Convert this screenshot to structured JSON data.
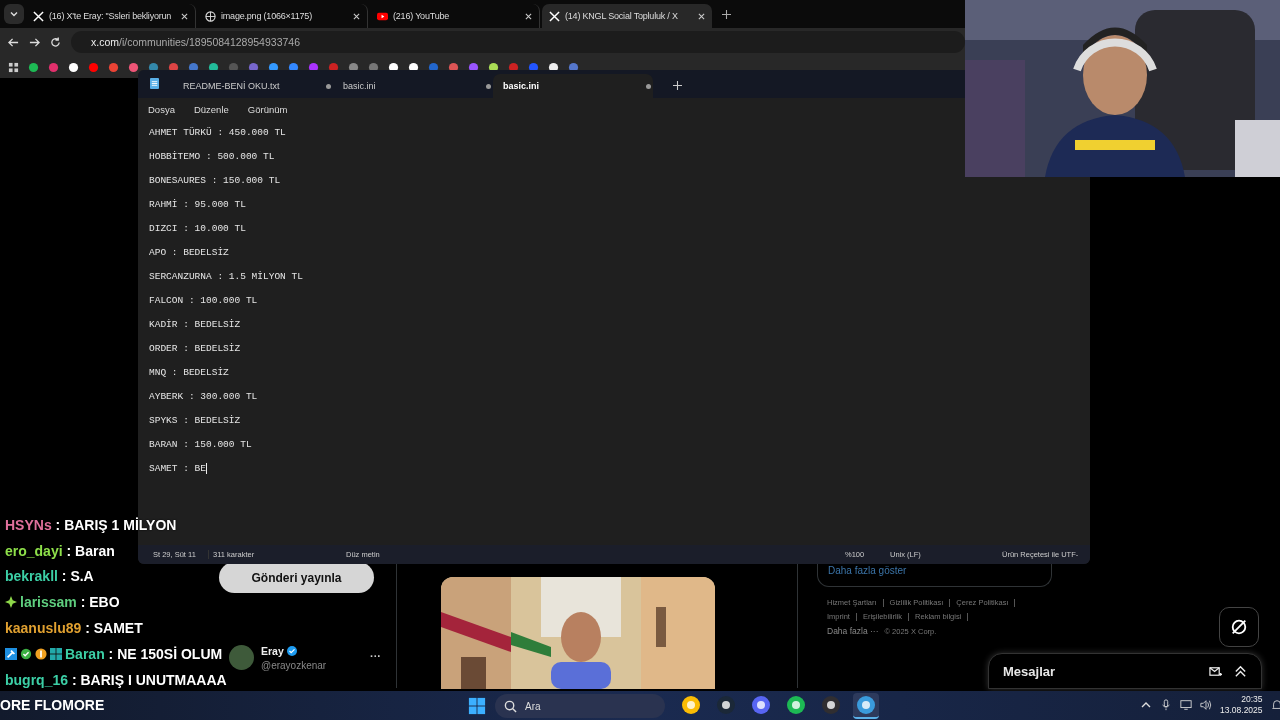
{
  "browser": {
    "tabs": [
      {
        "title": "(16) X'te Eray: \"Ssleri bekliyorun",
        "kind": "x",
        "selected": false
      },
      {
        "title": "image.png (1066×1175)",
        "kind": "globe",
        "selected": false
      },
      {
        "title": "(216) YouTube",
        "kind": "youtube",
        "selected": false
      },
      {
        "title": "(14) KNGL Social Topluluk / X",
        "kind": "x",
        "selected": true
      }
    ],
    "address": {
      "host": "x.com",
      "path": "/i/communities/1895084128954933746"
    },
    "page": {
      "post_button": "Gönderi yayınla",
      "author": {
        "name": "Eray",
        "handle": "@erayozkenar",
        "menu": "···"
      },
      "show_more": "Daha fazla göster",
      "footer_links": [
        "Hizmet Şartları",
        "Gizlilik Politikası",
        "Çerez Politikası",
        "Imprint",
        "Erişilebilirlik",
        "Reklam bilgisi"
      ],
      "more": "Daha fazla ···",
      "copyright": "© 2025 X Corp.",
      "messages": "Mesajlar"
    }
  },
  "notepad": {
    "tabs": [
      {
        "title": "README-BENİ OKU.txt",
        "selected": false
      },
      {
        "title": "basic.ini",
        "selected": false
      },
      {
        "title": "basic.ini",
        "selected": true
      }
    ],
    "menu": [
      "Dosya",
      "Düzenle",
      "Görünüm"
    ],
    "lines": [
      "AHMET TÜRKÜ : 450.000 TL",
      "HOBBİTEMO : 500.000 TL",
      "BONESAURES : 150.000 TL",
      "RAHMİ : 95.000 TL",
      "DIZCI : 10.000 TL",
      "APO : BEDELSİZ",
      "SERCANZURNA : 1.5 MİLYON TL",
      "FALCON : 100.000 TL",
      "KADİR : BEDELSİZ",
      "ORDER : BEDELSİZ",
      "MNQ : BEDELSİZ",
      "AYBERK : 300.000 TL",
      "SPYKS : BEDELSİZ",
      "BARAN : 150.000 TL",
      "SAMET : BE"
    ],
    "status": {
      "position": "St 29, Süt 11",
      "characters": "311 karakter",
      "format": "Düz metin",
      "zoom": "%100",
      "line_endings": "Unix (LF)",
      "encoding": "Ürün Reçetesi ile UTF-"
    }
  },
  "chat": [
    {
      "user": "HSYNs",
      "message": ": BARIŞ 1 MİLYON",
      "color": "#e0709c",
      "kind": "plain"
    },
    {
      "user": "ero_dayi",
      "message": ": Baran",
      "color": "#8ee04a",
      "kind": "plain"
    },
    {
      "user": "bekrakll",
      "message": ": S.A",
      "color": "#3ccfa6",
      "kind": "plain"
    },
    {
      "user": "larissam",
      "message": ": EBO",
      "color": "#5fcf7f",
      "kind": "diamond"
    },
    {
      "user": "kaanuslu89",
      "message": ": SAMET",
      "color": "#e0a030",
      "kind": "plain"
    },
    {
      "user": "Baran",
      "message": ": NE 150Sİ OLUM",
      "color": "#3ccfa6",
      "kind": "badges"
    },
    {
      "user": "bugrq_16",
      "message": ": BARIŞ I UNUTMAAAA",
      "color": "#3ccfa6",
      "kind": "plain"
    }
  ],
  "ticker": "ORE FLOMORE",
  "taskbar": {
    "search_placeholder": "Ara",
    "apps": [
      {
        "kind": "chrome",
        "selected": false
      },
      {
        "kind": "steam",
        "selected": false
      },
      {
        "kind": "discord",
        "selected": false
      },
      {
        "kind": "spotify",
        "selected": false
      },
      {
        "kind": "obs",
        "selected": false
      },
      {
        "kind": "notepad",
        "selected": true
      }
    ],
    "time": "20:35",
    "date": "13.08.2025"
  }
}
